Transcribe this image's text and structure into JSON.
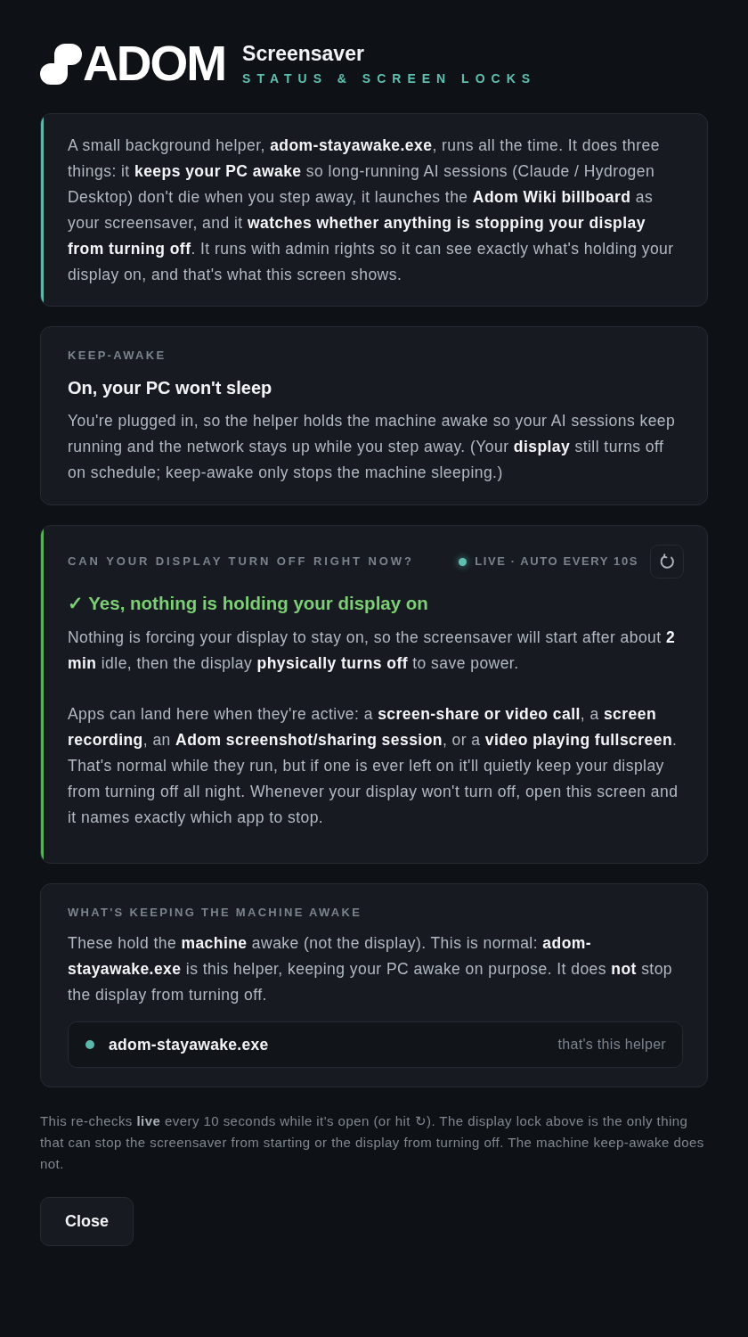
{
  "header": {
    "logo_text": "ADOM",
    "title": "Screensaver",
    "subtitle": "STATUS & SCREEN LOCKS"
  },
  "cards": [
    {
      "kind": "intro",
      "color": "#5bb8ad",
      "paragraphs": [
        "A small background helper, **adom-stayawake.exe**, runs all the time. It does three things: it **keeps your PC awake** so long-running AI sessions (Claude / Hydrogen Desktop) don't die when you step away, it launches the **Adom Wiki billboard** as your screensaver, and it **watches whether anything is stopping your display from turning off**. It runs with admin rights so it can see exactly what's holding your display on, and that's what this screen shows."
      ]
    },
    {
      "kind": "section",
      "label": "KEEP-AWAKE",
      "heading": "On, your PC won't sleep",
      "paragraphs": [
        "You're plugged in, so the helper holds the machine awake so your AI sessions keep running and the network stays up while you step away. (Your **display** still turns off on schedule; keep-awake only stops the machine sleeping.)"
      ]
    },
    {
      "kind": "status",
      "color": "#56b35a",
      "label": "CAN YOUR DISPLAY TURN OFF RIGHT NOW?",
      "live_text": "LIVE · AUTO EVERY 10S",
      "ok": true,
      "heading": "✓ Yes, nothing is holding your display on",
      "paragraphs": [
        "Nothing is forcing your display to stay on, so the screensaver will start after about **2 min** idle, then the display **physically turns off** to save power.",
        "Apps can land here when they're active: a **screen-share or video call**, a **screen recording**, an **Adom screenshot/sharing session**, or a **video playing fullscreen**. That's normal while they run, but if one is ever left on it'll quietly keep your display from turning off all night. Whenever your display won't turn off, open this screen and it names exactly which app to stop."
      ]
    },
    {
      "kind": "list",
      "label": "WHAT'S KEEPING THE MACHINE AWAKE",
      "paragraphs": [
        "These hold the **machine** awake (not the display). This is normal: **adom-stayawake.exe** is this helper, keeping your PC awake on purpose. It does **not** stop the display from turning off."
      ],
      "items": [
        {
          "name": "adom-stayawake.exe",
          "note": "that's this helper",
          "color": "#5bb8ad"
        }
      ]
    }
  ],
  "footnote": "This re-checks **live** every 10 seconds while it's open (or hit ↻). The display lock above is the only thing that can stop the screensaver from starting or the display from turning off. The machine keep-awake does not.",
  "buttons": [
    "Close"
  ]
}
